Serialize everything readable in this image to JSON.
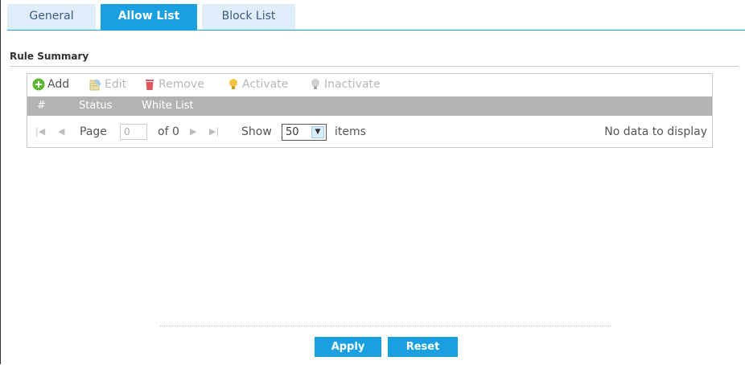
{
  "tabs": [
    {
      "label": "General",
      "active": false
    },
    {
      "label": "Allow List",
      "active": true
    },
    {
      "label": "Block List",
      "active": false
    }
  ],
  "section": {
    "title": "Rule Summary"
  },
  "toolbar": {
    "add": "Add",
    "edit": "Edit",
    "remove": "Remove",
    "activate": "Activate",
    "inactivate": "Inactivate"
  },
  "grid": {
    "columns": [
      "#",
      "Status",
      "White List"
    ],
    "rows": []
  },
  "pager": {
    "page_label": "Page",
    "page_value": "0",
    "of_label": "of 0",
    "show_label": "Show",
    "page_size": "50",
    "items_label": "items",
    "empty_text": "No data to display"
  },
  "footer": {
    "apply": "Apply",
    "reset": "Reset"
  },
  "colors": {
    "accent": "#1a9fe0",
    "tab_inactive": "#dfeefa",
    "header_gray": "#b3b3b3",
    "add_green": "#5cb82c",
    "remove_red": "#e0565f",
    "bulb_yellow": "#f5c542"
  },
  "icons": {
    "add": "plus-circle-icon",
    "edit": "edit-icon",
    "remove": "trash-icon",
    "activate": "lightbulb-icon",
    "inactivate": "lightbulb-off-icon"
  }
}
